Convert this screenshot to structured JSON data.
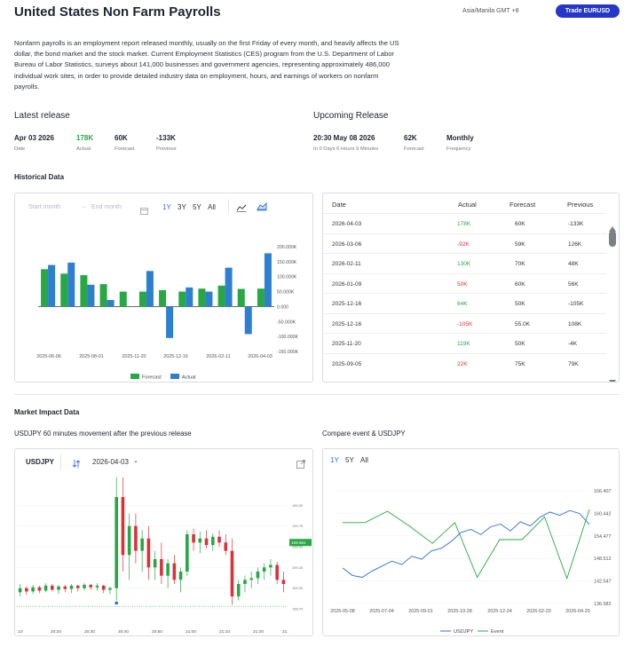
{
  "header": {
    "title": "United States Non Farm Payrolls",
    "timezone": "Asia/Manila GMT +8",
    "trade_button": "Trade  EURUSD",
    "description": "Nonfarm payrolls is an employment report released monthly, usually on the first Friday of every month, and heavily affects the US dollar, the bond market and the stock market. Current Employment Statistics (CES) program from the U.S. Department of Labor Bureau of Labor Statistics, surveys about 141,000 businesses and government agencies, representing approximately 486,000 individual work sites, in order to provide detailed industry data on employment, hours, and earnings of workers on nonfarm payrolls."
  },
  "latest_release": {
    "heading": "Latest release",
    "date": "Apr 03 2026",
    "date_label": "Date",
    "actual": "178K",
    "actual_label": "Actual",
    "forecast": "60K",
    "forecast_label": "Forecast",
    "previous": "-133K",
    "previous_label": "Previous"
  },
  "upcoming_release": {
    "heading": "Upcoming Release",
    "datetime": "20:30 May 08 2026",
    "countdown": "In 0 Days 6 Hours 9 Minutes",
    "forecast": "62K",
    "forecast_label": "Forecast",
    "frequency": "Monthly",
    "frequency_label": "Frequency"
  },
  "historical": {
    "heading": "Historical Data",
    "start_placeholder": "Start month",
    "end_placeholder": "End month",
    "ranges": [
      "1Y",
      "3Y",
      "5Y",
      "All"
    ],
    "active_range": "1Y",
    "legend_forecast": "Forecast",
    "legend_actual": "Actual"
  },
  "history_table": {
    "columns": [
      "Date",
      "Actual",
      "Forecast",
      "Previous"
    ],
    "rows": [
      {
        "date": "2026-04-03",
        "actual": "178K",
        "forecast": "60K",
        "previous": "-133K",
        "actual_sign": "pos"
      },
      {
        "date": "2026-03-06",
        "actual": "-92K",
        "forecast": "59K",
        "previous": "126K",
        "actual_sign": "neg"
      },
      {
        "date": "2026-02-11",
        "actual": "130K",
        "forecast": "70K",
        "previous": "48K",
        "actual_sign": "pos"
      },
      {
        "date": "2026-01-09",
        "actual": "50K",
        "forecast": "60K",
        "previous": "56K",
        "actual_sign": "neg"
      },
      {
        "date": "2025-12-16",
        "actual": "64K",
        "forecast": "50K",
        "previous": "-105K",
        "actual_sign": "pos"
      },
      {
        "date": "2025-12-16",
        "actual": "-105K",
        "forecast": "55.0K",
        "previous": "108K",
        "actual_sign": "neg"
      },
      {
        "date": "2025-11-20",
        "actual": "119K",
        "forecast": "50K",
        "previous": "-4K",
        "actual_sign": "pos"
      },
      {
        "date": "2025-09-05",
        "actual": "22K",
        "forecast": "75K",
        "previous": "79K",
        "actual_sign": "neg"
      }
    ]
  },
  "market_impact": {
    "heading": "Market Impact Data",
    "left_title": "USDJPY 60 minutes movement after the previous release",
    "right_title": "Compare event & USDJPY",
    "symbol": "USDJPY",
    "date": "2026-04-03",
    "price_tag": "159.551",
    "ranges": [
      "1Y",
      "5Y",
      "All"
    ],
    "active_range": "1Y",
    "legend_usdjpy": "USDJPY",
    "legend_event": "Event"
  },
  "colors": {
    "accent": "#2536c8",
    "forecast_green": "#27a844",
    "actual_blue": "#2d7fcf",
    "negative_red": "#d9323a",
    "candle_up": "#27a844",
    "candle_down": "#d9323a"
  },
  "chart_data": [
    {
      "type": "bar",
      "title": "",
      "categories": [
        "2025-06-06",
        "2025-07-03",
        "2025-08-01",
        "2025-09-05",
        "2025-10-03",
        "2025-11-20",
        "2025-12-16",
        "2025-12-16b",
        "2026-01-09",
        "2026-02-11",
        "2026-03-06",
        "2026-04-03"
      ],
      "x_tick_labels": [
        "2025-06-06",
        "2025-08-01",
        "2025-11-20",
        "2025-12-16",
        "2026-02-11",
        "2026-04-03"
      ],
      "series": [
        {
          "name": "Forecast",
          "values": [
            125,
            110,
            105,
            75,
            50,
            50,
            55,
            50,
            60,
            70,
            59,
            60
          ]
        },
        {
          "name": "Actual",
          "values": [
            139,
            147,
            73,
            22,
            0,
            119,
            -105,
            64,
            50,
            130,
            -92,
            178
          ]
        }
      ],
      "yticks": [
        "200.000K",
        "150.000K",
        "100.000K",
        "50.000K",
        "0.000",
        "-50.000K",
        "-100.000K",
        "-150.000K"
      ],
      "ylim": [
        -150,
        200
      ],
      "legend": "bottom"
    },
    {
      "type": "line",
      "title": "",
      "series": [
        {
          "name": "USDJPY",
          "values": [
            159.0,
            159.0,
            159.8,
            159.6,
            159.7,
            159.5,
            159.55
          ]
        }
      ],
      "candles": [
        [
          158.95,
          159.05,
          158.9,
          159.0
        ],
        [
          159.0,
          159.02,
          158.92,
          158.96
        ],
        [
          158.96,
          159.04,
          158.93,
          159.01
        ],
        [
          159.01,
          159.03,
          158.94,
          158.97
        ],
        [
          158.97,
          159.06,
          158.95,
          159.03
        ],
        [
          159.03,
          159.05,
          158.96,
          158.98
        ],
        [
          158.98,
          159.04,
          158.93,
          159.02
        ],
        [
          159.02,
          159.04,
          158.95,
          158.99
        ],
        [
          158.99,
          159.05,
          158.94,
          159.03
        ],
        [
          159.03,
          159.04,
          158.96,
          159.0
        ],
        [
          159.0,
          159.06,
          158.97,
          159.04
        ],
        [
          159.04,
          159.05,
          158.98,
          159.01
        ],
        [
          159.01,
          159.06,
          158.97,
          159.03
        ],
        [
          159.03,
          159.04,
          158.94,
          158.98
        ],
        [
          158.98,
          159.02,
          158.93,
          159.0
        ],
        [
          159.0,
          160.9,
          158.85,
          160.1
        ],
        [
          160.1,
          160.35,
          159.2,
          159.4
        ],
        [
          159.4,
          159.9,
          159.1,
          159.75
        ],
        [
          159.75,
          159.9,
          159.3,
          159.45
        ],
        [
          159.45,
          159.7,
          159.2,
          159.6
        ],
        [
          159.6,
          159.75,
          159.1,
          159.25
        ],
        [
          159.25,
          159.45,
          159.1,
          159.35
        ],
        [
          159.35,
          159.55,
          159.05,
          159.15
        ],
        [
          159.15,
          159.35,
          159.0,
          159.3
        ],
        [
          159.3,
          159.4,
          159.05,
          159.1
        ],
        [
          159.1,
          159.25,
          158.95,
          159.2
        ],
        [
          159.2,
          159.7,
          159.15,
          159.65
        ],
        [
          159.65,
          159.72,
          159.45,
          159.55
        ],
        [
          159.55,
          159.68,
          159.42,
          159.6
        ],
        [
          159.6,
          159.7,
          159.48,
          159.52
        ],
        [
          159.52,
          159.66,
          159.45,
          159.62
        ],
        [
          159.62,
          159.7,
          159.5,
          159.55
        ],
        [
          159.55,
          159.65,
          159.4,
          159.45
        ],
        [
          159.45,
          159.6,
          158.8,
          158.9
        ],
        [
          158.9,
          159.1,
          158.85,
          159.05
        ],
        [
          159.05,
          159.15,
          158.95,
          159.1
        ],
        [
          159.1,
          159.2,
          159.0,
          159.12
        ],
        [
          159.12,
          159.25,
          159.05,
          159.2
        ],
        [
          159.2,
          159.3,
          159.1,
          159.25
        ],
        [
          159.25,
          159.35,
          159.15,
          159.28
        ],
        [
          159.28,
          159.32,
          159.05,
          159.1
        ],
        [
          159.1,
          159.2,
          158.95,
          159.05
        ]
      ],
      "x_tick_labels": [
        ":10",
        "20:20",
        "20:30",
        "20:40",
        "20:50",
        "21:00",
        "21:10",
        "21:20",
        "21:"
      ],
      "y_tick_labels": [
        "160.00",
        "159.75",
        "159.50",
        "159.25",
        "159.00",
        "158.75"
      ],
      "current_price": 159.551
    },
    {
      "type": "line",
      "title": "",
      "x_tick_labels": [
        "2025-05-08",
        "2025-07-04",
        "2025-09-01",
        "2025-10-28",
        "2025-12-24",
        "2026-02-20",
        "2026-04-20"
      ],
      "y_tick_labels": [
        "166.407",
        "160.442",
        "154.477",
        "148.512",
        "142.547",
        "136.582"
      ],
      "ylim": [
        136.582,
        166.407
      ],
      "series": [
        {
          "name": "USDJPY",
          "values": [
            146.0,
            144.0,
            143.5,
            145.2,
            146.5,
            147.8,
            146.9,
            149.1,
            148.3,
            150.5,
            151.2,
            153.0,
            155.4,
            156.2,
            154.8,
            156.9,
            157.6,
            155.8,
            158.2,
            157.1,
            159.4,
            160.8,
            159.9,
            161.2,
            160.4,
            157.5
          ]
        },
        {
          "name": "Event",
          "values": [
            158.0,
            158.0,
            161.0,
            157.0,
            152.5,
            158.0,
            143.5,
            153.5,
            153.5,
            159.5,
            143.2,
            161.5
          ]
        }
      ],
      "legend": "bottom"
    }
  ]
}
